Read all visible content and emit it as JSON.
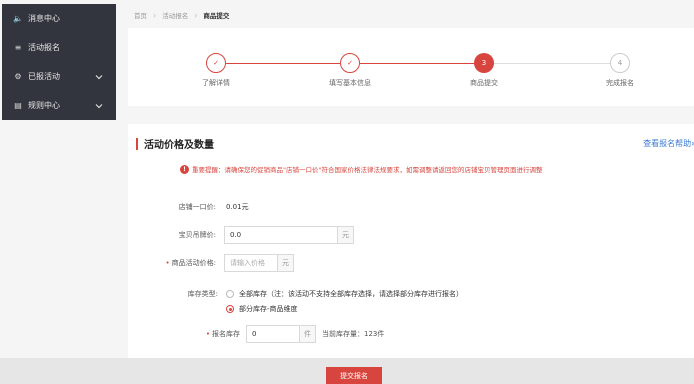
{
  "sidebar": {
    "items": [
      {
        "label": "消息中心",
        "icon": "speaker-icon",
        "glyph": "🔈"
      },
      {
        "label": "活动报名",
        "icon": "bars-icon",
        "glyph": "≡"
      },
      {
        "label": "已报活动",
        "icon": "gear-icon",
        "glyph": "⚙"
      },
      {
        "label": "规则中心",
        "icon": "document-icon",
        "glyph": "▤"
      }
    ]
  },
  "breadcrumb": {
    "items": [
      "首页",
      "活动报名",
      "商品提交"
    ]
  },
  "steps": [
    {
      "label": "了解详情",
      "mark": "✓",
      "status": "done"
    },
    {
      "label": "填写基本信息",
      "mark": "✓",
      "status": "done"
    },
    {
      "label": "商品提交",
      "mark": "3",
      "status": "active"
    },
    {
      "label": "完成报名",
      "mark": "4",
      "status": "todo"
    }
  ],
  "form": {
    "section_title": "活动价格及数量",
    "help_link": "查看报名帮助»",
    "notice": "重要提醒：请确保您的促销商品\"店铺一口价\"符合国家价格法律法规要求，如需调整请返回您的店铺宝贝管理页面进行调整",
    "store_price": {
      "label": "店铺一口价:",
      "value": "0.01元"
    },
    "tag_price": {
      "label": "宝贝吊牌价:",
      "value": "0.0",
      "unit": "元"
    },
    "activity_price": {
      "label": "商品活动价格:",
      "placeholder": "请输入价格",
      "unit": "元"
    },
    "inventory_type": {
      "label": "库存类型:",
      "options": [
        {
          "label": "全部库存（注：该活动不支持全部库存选择，请选择部分库存进行报名）",
          "selected": false
        },
        {
          "label": "部分库存-商品维度",
          "selected": true
        }
      ]
    },
    "signup_stock": {
      "label": "报名库存",
      "value": "0",
      "unit": "件",
      "current_stock": "当前库存量：123件"
    }
  },
  "submit_label": "提交报名"
}
